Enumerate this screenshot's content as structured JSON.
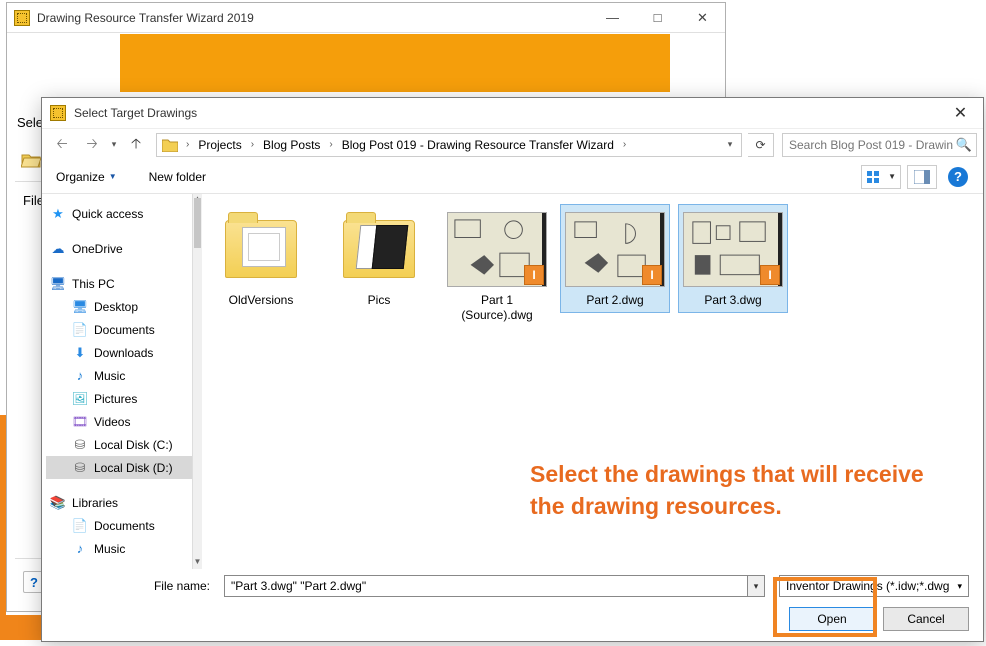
{
  "parent": {
    "title": "Drawing Resource Transfer Wizard 2019",
    "left_label": "Sele",
    "file_label": "File"
  },
  "dialog": {
    "title": "Select Target Drawings",
    "breadcrumb": [
      "Projects",
      "Blog Posts",
      "Blog Post 019 - Drawing Resource Transfer Wizard"
    ],
    "search_placeholder": "Search Blog Post 019 - Drawin...",
    "toolbar": {
      "organize": "Organize",
      "new_folder": "New folder"
    }
  },
  "tree": {
    "quick": "Quick access",
    "onedrive": "OneDrive",
    "thispc": "This PC",
    "desktop": "Desktop",
    "documents": "Documents",
    "downloads": "Downloads",
    "music": "Music",
    "pictures": "Pictures",
    "videos": "Videos",
    "diskc": "Local Disk (C:)",
    "diskd": "Local Disk (D:)",
    "libraries": "Libraries",
    "lib_documents": "Documents",
    "lib_music": "Music"
  },
  "files": [
    {
      "name": "OldVersions",
      "type": "folder-old",
      "selected": false
    },
    {
      "name": "Pics",
      "type": "folder-pics",
      "selected": false
    },
    {
      "name": "Part 1 (Source).dwg",
      "type": "dwg",
      "selected": false
    },
    {
      "name": "Part 2.dwg",
      "type": "dwg",
      "selected": true
    },
    {
      "name": "Part 3.dwg",
      "type": "dwg",
      "selected": true
    }
  ],
  "annotation": "Select the drawings that will receive the drawing resources.",
  "footer": {
    "filename_label": "File name:",
    "filename_value": "\"Part 3.dwg\" \"Part 2.dwg\"",
    "filter": "Inventor Drawings (*.idw;*.dwg",
    "open": "Open",
    "cancel": "Cancel"
  }
}
